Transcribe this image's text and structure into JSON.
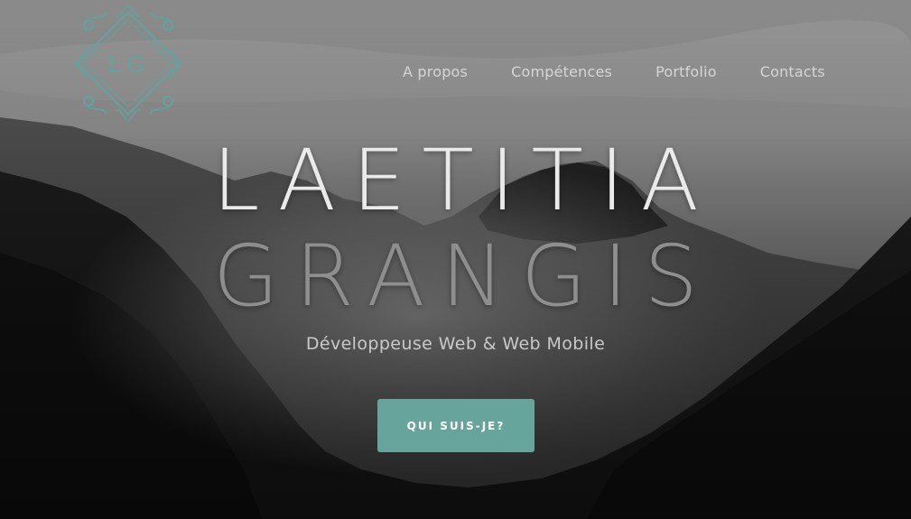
{
  "logo": {
    "initials": "LG",
    "color": "#5fa49d"
  },
  "nav": {
    "items": [
      {
        "label": "A propos"
      },
      {
        "label": "Compétences"
      },
      {
        "label": "Portfolio"
      },
      {
        "label": "Contacts"
      }
    ]
  },
  "hero": {
    "first_name": "LAETITIA",
    "last_name": "GRANGIS",
    "subtitle": "Développeuse Web & Web Mobile",
    "cta_label": "QUI SUIS-JE?",
    "accent_color": "#66a49c"
  }
}
